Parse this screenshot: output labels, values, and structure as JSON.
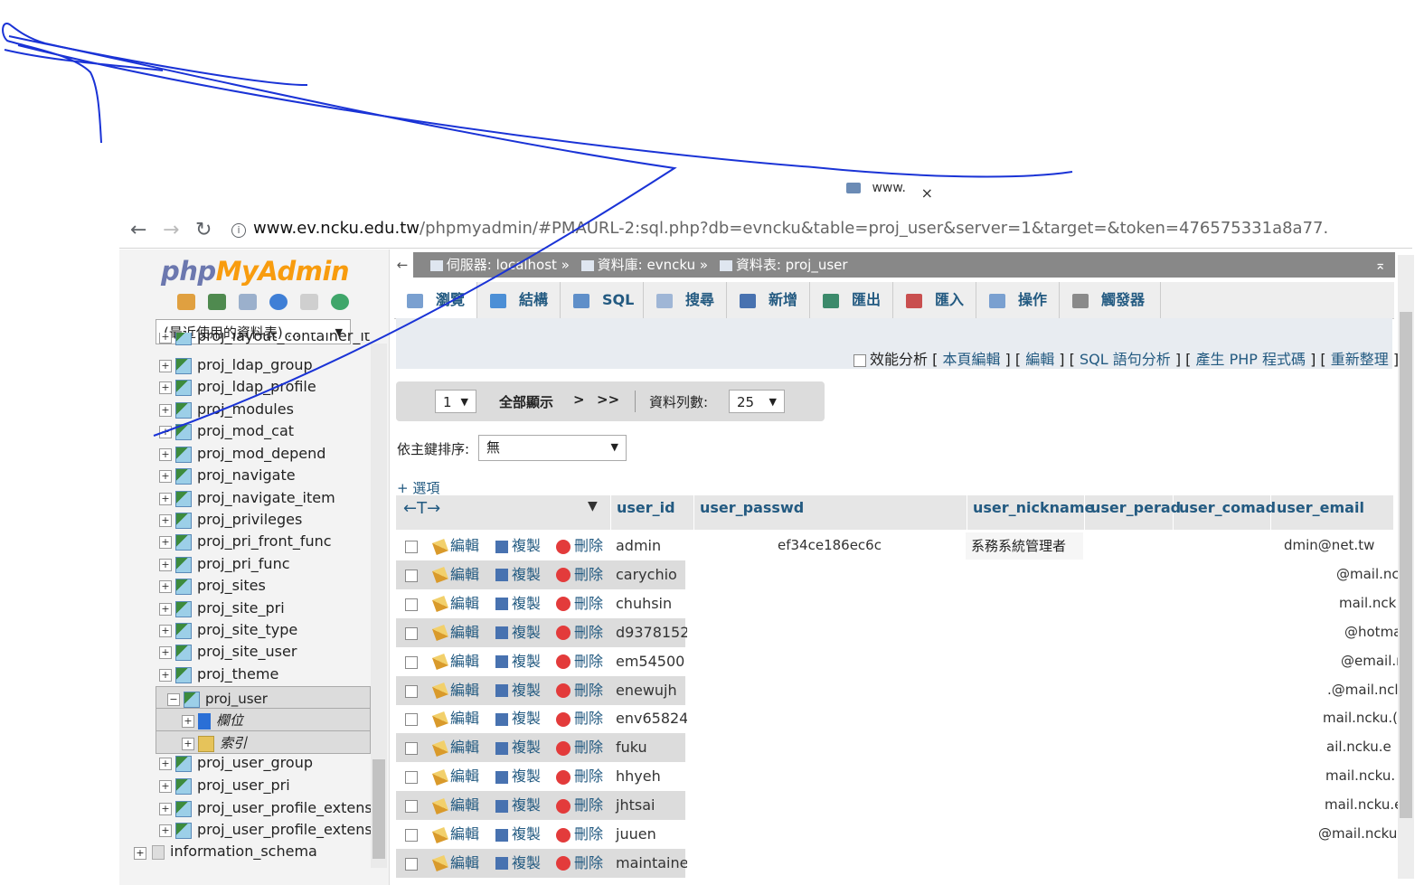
{
  "browser": {
    "tab_label": "www.",
    "tab_close": "×",
    "back": "←",
    "forward": "→",
    "reload": "↻",
    "info": "i",
    "url_host": "www.ev.ncku.edu.tw",
    "url_path": "/phpmyadmin/#PMAURL-2:sql.php?db=evncku&table=proj_user&server=1&target=&token=476575331a8a77."
  },
  "sidebar": {
    "logo_php": "php",
    "logo_myadmin": "MyAdmin",
    "recent_select": "(最近使用的資料表) ...",
    "tables": [
      {
        "name": "proj_layout_container_item",
        "selected": false
      },
      {
        "name": "proj_ldap_group",
        "selected": false
      },
      {
        "name": "proj_ldap_profile",
        "selected": false
      },
      {
        "name": "proj_modules",
        "selected": false
      },
      {
        "name": "proj_mod_cat",
        "selected": false
      },
      {
        "name": "proj_mod_depend",
        "selected": false
      },
      {
        "name": "proj_navigate",
        "selected": false
      },
      {
        "name": "proj_navigate_item",
        "selected": false
      },
      {
        "name": "proj_privileges",
        "selected": false
      },
      {
        "name": "proj_pri_front_func",
        "selected": false
      },
      {
        "name": "proj_pri_func",
        "selected": false
      },
      {
        "name": "proj_sites",
        "selected": false
      },
      {
        "name": "proj_site_pri",
        "selected": false
      },
      {
        "name": "proj_site_type",
        "selected": false
      },
      {
        "name": "proj_site_user",
        "selected": false
      },
      {
        "name": "proj_theme",
        "selected": false
      },
      {
        "name": "proj_user",
        "selected": true
      },
      {
        "name": "proj_user_group",
        "selected": false
      },
      {
        "name": "proj_user_pri",
        "selected": false
      },
      {
        "name": "proj_user_profile_extension",
        "selected": false
      },
      {
        "name": "proj_user_profile_extension",
        "selected": false
      }
    ],
    "sub_columns": "欄位",
    "sub_indexes": "索引",
    "info_schema": "information_schema"
  },
  "breadcrumb": {
    "back": "←",
    "server": "伺服器: localhost »",
    "database": "資料庫: evncku »",
    "table": "資料表: proj_user",
    "collapse": "⌅"
  },
  "tabs": [
    {
      "label": "瀏覽",
      "color": "#7aa0d0"
    },
    {
      "label": "結構",
      "color": "#4c8fd6"
    },
    {
      "label": "SQL",
      "color": "#5f8fc9"
    },
    {
      "label": "搜尋",
      "color": "#9fb6d6"
    },
    {
      "label": "新增",
      "color": "#4872b0"
    },
    {
      "label": "匯出",
      "color": "#3c8a6b"
    },
    {
      "label": "匯入",
      "color": "#c94f4f"
    },
    {
      "label": "操作",
      "color": "#7aa0d0"
    },
    {
      "label": "觸發器",
      "color": "#8a8a8a"
    }
  ],
  "profiling": {
    "checkbox_label": "效能分析",
    "links": [
      "本頁編輯",
      "編輯",
      "SQL 語句分析",
      "產生 PHP 程式碼",
      "重新整理"
    ]
  },
  "navigation": {
    "page": "1",
    "show_all": "全部顯示",
    "next": ">",
    "last": ">>",
    "rows_label": "資料列數:",
    "rows_value": "25",
    "sort_label": "依主鍵排序:",
    "sort_value": "無",
    "options": "+ 選項"
  },
  "table": {
    "arrows": "←T→",
    "caret": "▼",
    "columns": [
      "user_id",
      "user_passwd",
      "user_nickname",
      "user_perad",
      "user_comad",
      "user_email"
    ],
    "actions": {
      "edit": "編輯",
      "copy": "複製",
      "delete": "刪除"
    },
    "rows": [
      {
        "user_id": "admin",
        "passwd": "ef34ce186ec6c",
        "nickname": "系務系統管理者",
        "email": "dmin@net.tw"
      },
      {
        "user_id": "carychio",
        "passwd": "",
        "nickname": "",
        "email": "@mail.ncl"
      },
      {
        "user_id": "chuhsin",
        "passwd": "",
        "nickname": "",
        "email": "mail.nck"
      },
      {
        "user_id": "d9378152",
        "passwd": "",
        "nickname": "",
        "email": "@hotma"
      },
      {
        "user_id": "em54500",
        "passwd": "",
        "nickname": "",
        "email": "@email.r"
      },
      {
        "user_id": "enewujh",
        "passwd": "",
        "nickname": "",
        "email": ".@mail.ncl"
      },
      {
        "user_id": "env65824",
        "passwd": "",
        "nickname": "",
        "email": "mail.ncku.("
      },
      {
        "user_id": "fuku",
        "passwd": "",
        "nickname": "",
        "email": "ail.ncku.e"
      },
      {
        "user_id": "hhyeh",
        "passwd": "",
        "nickname": "",
        "email": "mail.ncku."
      },
      {
        "user_id": "jhtsai",
        "passwd": "",
        "nickname": "",
        "email": "mail.ncku.e"
      },
      {
        "user_id": "juuen",
        "passwd": "",
        "nickname": "",
        "email": "@mail.ncku."
      },
      {
        "user_id": "maintainer",
        "passwd": "",
        "nickname": "",
        "email": ""
      }
    ]
  },
  "colors": {
    "accent_link": "#235a81",
    "pen_annotation": "#1a33d6"
  }
}
